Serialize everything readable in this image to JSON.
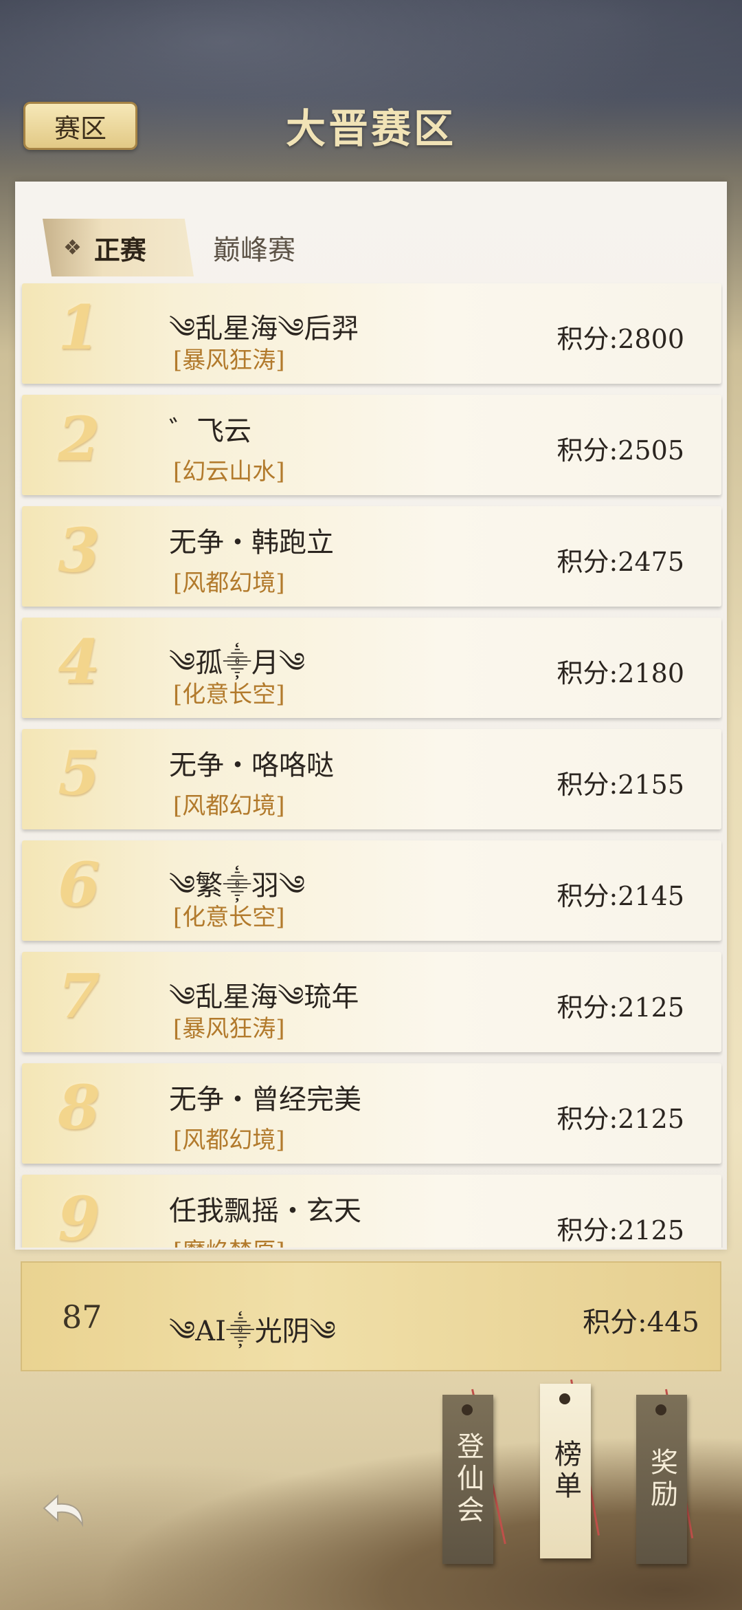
{
  "header": {
    "zone_button": "赛区",
    "title": "大晋赛区"
  },
  "tabs": [
    {
      "label": "正赛",
      "active": true
    },
    {
      "label": "巅峰赛",
      "active": false
    }
  ],
  "rankings": [
    {
      "rank": "1",
      "name": "༄乱星海༄后羿",
      "server": "[暴风狂涛]",
      "score": "积分:2800"
    },
    {
      "rank": "2",
      "name": "゛飞云",
      "server": "[幻云山水]",
      "score": "积分:2505"
    },
    {
      "rank": "3",
      "name": "无争・韩跑立",
      "server": "[风都幻境]",
      "score": "积分:2475"
    },
    {
      "rank": "4",
      "name": "༄孤⸎月༄",
      "server": "[化意长空]",
      "score": "积分:2180"
    },
    {
      "rank": "5",
      "name": "无争・咯咯哒",
      "server": "[风都幻境]",
      "score": "积分:2155"
    },
    {
      "rank": "6",
      "name": "༄繁⸎羽༄",
      "server": "[化意长空]",
      "score": "积分:2145"
    },
    {
      "rank": "7",
      "name": "༄乱星海༄琉年",
      "server": "[暴风狂涛]",
      "score": "积分:2125"
    },
    {
      "rank": "8",
      "name": "无争・曾经完美",
      "server": "[风都幻境]",
      "score": "积分:2125"
    },
    {
      "rank": "9",
      "name": "任我飘摇・玄天",
      "server": "[魔焰焚原]",
      "score": "积分:2125"
    }
  ],
  "my_rank": {
    "rank": "87",
    "name": "༄AI⸎光阴༄",
    "score": "积分:445"
  },
  "bottom_tags": [
    {
      "label": "登仙会",
      "style": "dark"
    },
    {
      "label": "榜单",
      "style": "light"
    },
    {
      "label": "奖励",
      "style": "dark"
    }
  ],
  "colors": {
    "server_text": "#b27a2c",
    "rank_numeral": "#f3d58c",
    "title_gold": "#f1e3b6"
  },
  "icons": {
    "back": "back-arrow-icon",
    "tab_marker": "diamond-icon"
  }
}
